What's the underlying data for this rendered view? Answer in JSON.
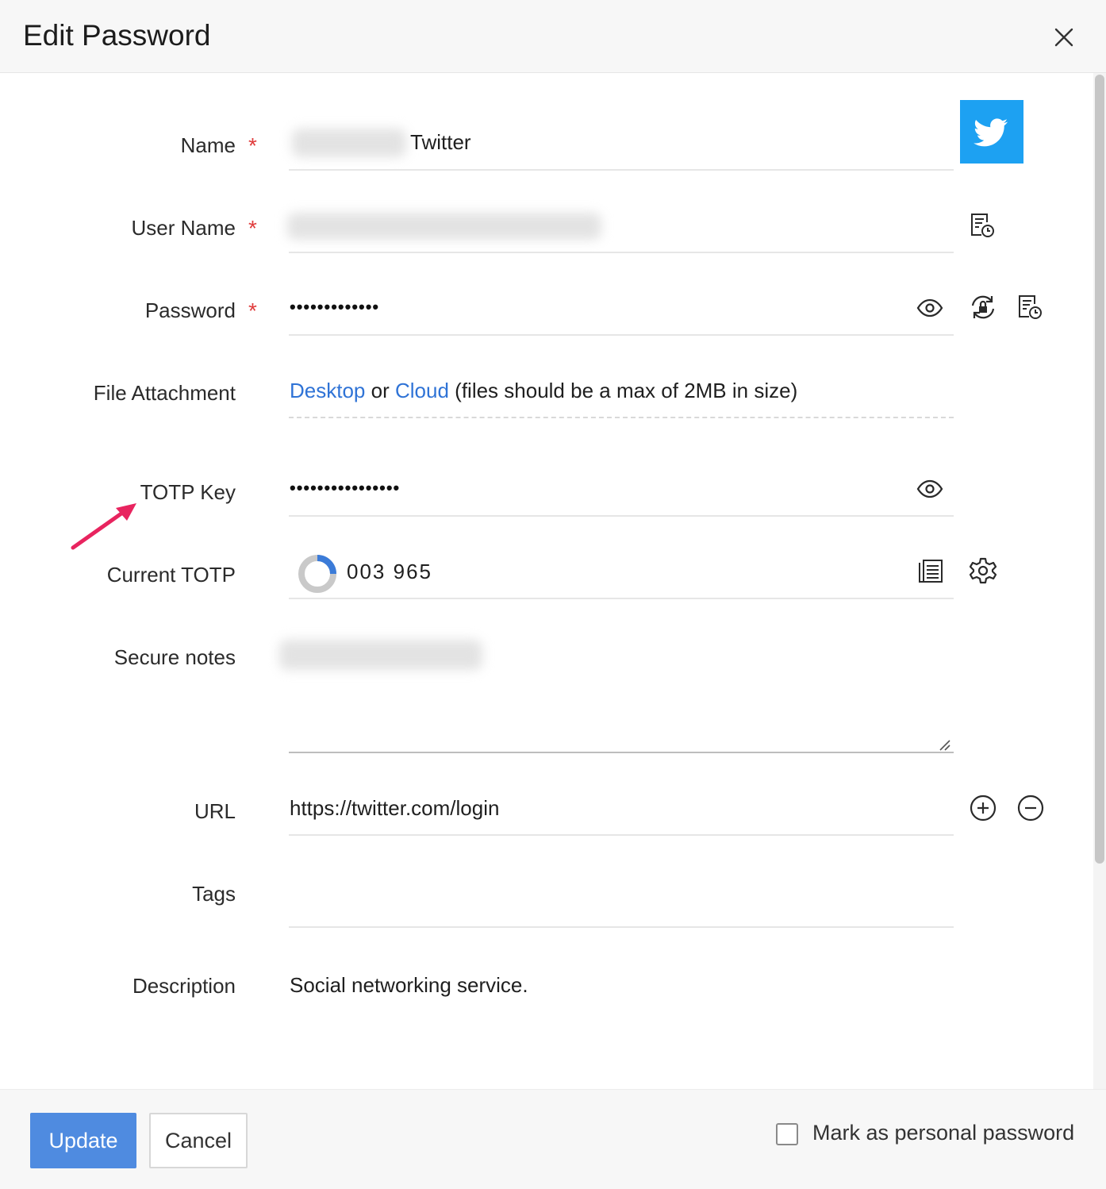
{
  "dialog": {
    "title": "Edit Password"
  },
  "fields": {
    "name": {
      "label": "Name",
      "required_mark": "*",
      "value": "Twitter"
    },
    "username": {
      "label": "User Name",
      "required_mark": "*"
    },
    "password": {
      "label": "Password",
      "required_mark": "*",
      "masked_value": "•••••••••••••"
    },
    "file_attachment": {
      "label": "File Attachment",
      "desktop_link": "Desktop",
      "or_text": "or",
      "cloud_link": "Cloud",
      "hint": "(files should be a max of 2MB in size)"
    },
    "totp_key": {
      "label": "TOTP Key",
      "masked_value": "••••••••••••••••"
    },
    "current_totp": {
      "label": "Current TOTP",
      "code": "003 965",
      "timer_progress": 0.25
    },
    "secure_notes": {
      "label": "Secure notes"
    },
    "url": {
      "label": "URL",
      "value": "https://twitter.com/login"
    },
    "tags": {
      "label": "Tags",
      "value": ""
    },
    "description": {
      "label": "Description",
      "value": "Social networking service."
    }
  },
  "footer": {
    "update_label": "Update",
    "cancel_label": "Cancel",
    "personal_label": "Mark as personal password",
    "personal_checked": false
  },
  "colors": {
    "accent": "#4f8be0",
    "link": "#2f73d6",
    "required": "#e03c3c",
    "twitter": "#1da1f2",
    "annotation_arrow": "#e8245f"
  },
  "icons": {
    "close": "close-icon",
    "twitter": "twitter-logo-icon",
    "history": "password-history-icon",
    "show": "eye-icon",
    "reset": "reset-password-icon",
    "copy": "copy-icon",
    "settings": "gear-icon",
    "add": "plus-circle-icon",
    "remove": "minus-circle-icon"
  }
}
